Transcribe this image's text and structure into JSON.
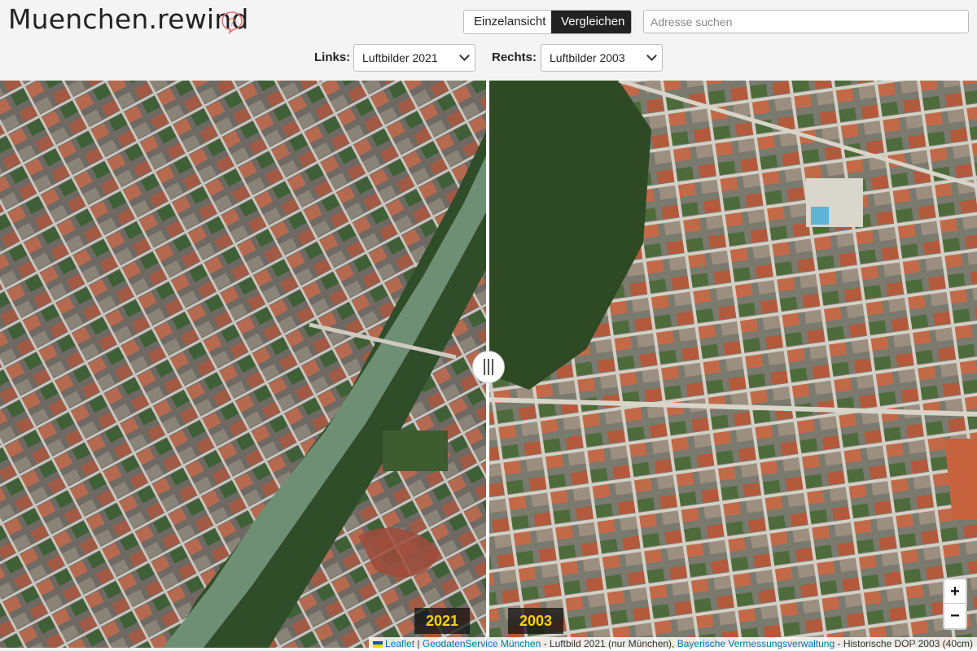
{
  "header": {
    "title": "Muenchen.rewind",
    "help_icon": "question-bubble-icon",
    "view_toggle": {
      "single": "Einzelansicht",
      "compare": "Vergleichen",
      "active": "compare"
    },
    "search": {
      "placeholder": "Adresse suchen",
      "value": ""
    },
    "left_label": "Links:",
    "left_value": "Luftbilder 2021",
    "right_label": "Rechts:",
    "right_value": "Luftbilder 2003"
  },
  "map": {
    "left_year": "2021",
    "right_year": "2003",
    "zoom_in": "+",
    "zoom_out": "−",
    "attribution": {
      "leaflet": "Leaflet",
      "sep1": " | ",
      "geodaten": "GeodatenService München",
      "text1": " - Luftbild 2021 (nur München), ",
      "bayern": "Bayerische Vermessungsverwaltung",
      "text2": " - Historische DOP 2003 (40cm)"
    }
  },
  "colors": {
    "accent": "#ffd000",
    "dark": "#222222",
    "link": "#0078a8"
  }
}
